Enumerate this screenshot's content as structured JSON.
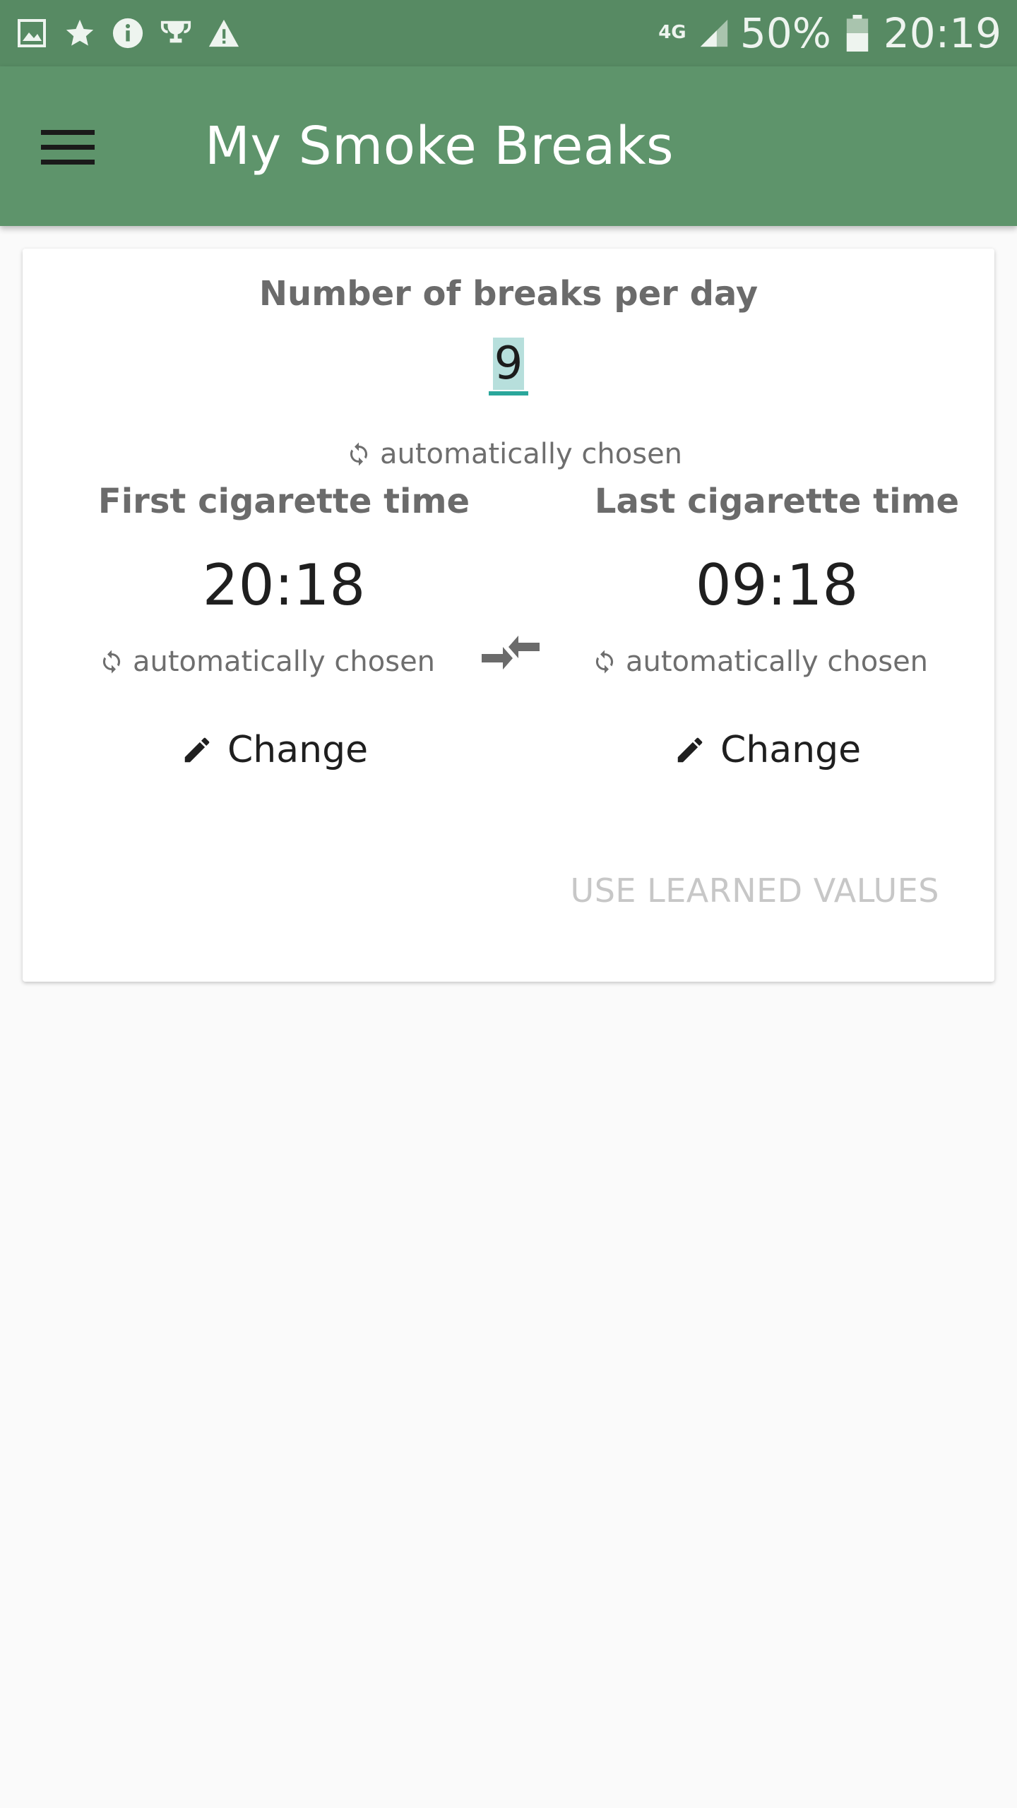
{
  "status_bar": {
    "left_icons": [
      "image-icon",
      "star-icon",
      "info-icon",
      "trophy-icon",
      "warning-icon"
    ],
    "network": "4G",
    "battery": "50%",
    "time": "20:19"
  },
  "app_bar": {
    "title": "My Smoke Breaks",
    "menu_icon": "hamburger-menu-icon"
  },
  "breaks": {
    "title": "Number of breaks per day",
    "value": "9",
    "auto_label": "automatically chosen"
  },
  "first": {
    "title": "First cigarette time",
    "time": "20:18",
    "auto_label": "automatically chosen",
    "change_label": "Change"
  },
  "last": {
    "title": "Last cigarette time",
    "time": "09:18",
    "auto_label": "automatically chosen",
    "change_label": "Change"
  },
  "actions": {
    "use_learned": "USE LEARNED VALUES"
  },
  "colors": {
    "status_bar": "#578a63",
    "app_bar": "#5e946b",
    "accent": "#2aa79b"
  }
}
